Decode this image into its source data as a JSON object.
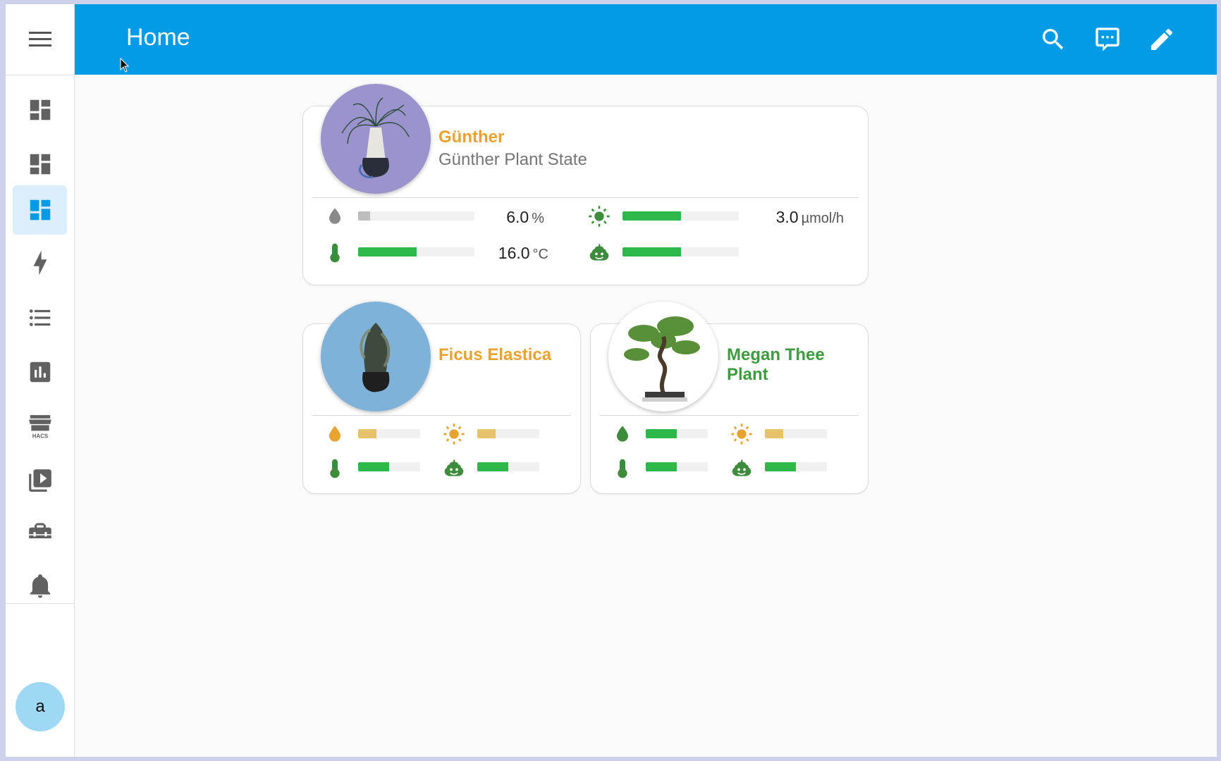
{
  "header": {
    "title": "Home",
    "icons": [
      "search-icon",
      "assist-icon",
      "edit-icon"
    ]
  },
  "sidebar": {
    "menu_icon": "menu-icon",
    "items": [
      {
        "icon": "dashboard-icon",
        "active": false
      },
      {
        "icon": "dashboard-icon",
        "active": false
      },
      {
        "icon": "dashboard-icon",
        "active": true
      },
      {
        "icon": "lightning-icon",
        "active": false
      },
      {
        "icon": "list-icon",
        "active": false
      },
      {
        "icon": "chart-box-icon",
        "active": false
      },
      {
        "icon": "store-icon",
        "active": false,
        "label": "HACS"
      },
      {
        "icon": "media-icon",
        "active": false
      },
      {
        "icon": "toolbox-icon",
        "active": false
      }
    ],
    "notification_icon": "bell-icon",
    "user_initial": "a"
  },
  "colors": {
    "header": "#039be5",
    "accent_active": "#dcedfb",
    "green": "#2db84c",
    "yellow": "#e8c16b",
    "gray": "#bdbdbd",
    "orange_name": "#e8a230",
    "green_name": "#3f9b3f"
  },
  "plants": [
    {
      "name": "Günther",
      "name_color": "#e8a230",
      "subtitle": "Günther Plant State",
      "attributes": [
        {
          "icon": "water-drop-icon",
          "fill": 0.1,
          "color": "#bdbdbd",
          "value": "6.0",
          "unit": "%"
        },
        {
          "icon": "sun-icon",
          "fill": 0.5,
          "color": "#2db84c",
          "value": "3.0",
          "unit": "µmol/h"
        },
        {
          "icon": "thermometer-icon",
          "fill": 0.5,
          "color": "#2db84c",
          "value": "16.0",
          "unit": "°C"
        },
        {
          "icon": "fertilizer-icon",
          "fill": 0.5,
          "color": "#2db84c",
          "value": "",
          "unit": ""
        }
      ]
    },
    {
      "name": "Ficus Elastica",
      "name_color": "#e8a230",
      "subtitle": "",
      "attributes": [
        {
          "icon": "water-drop-icon",
          "fill": 0.3,
          "color": "#e8c16b"
        },
        {
          "icon": "sun-icon",
          "fill": 0.3,
          "color": "#e8c16b"
        },
        {
          "icon": "thermometer-icon",
          "fill": 0.5,
          "color": "#2db84c"
        },
        {
          "icon": "fertilizer-icon",
          "fill": 0.5,
          "color": "#2db84c"
        }
      ]
    },
    {
      "name": "Megan Thee Plant",
      "name_color": "#3f9b3f",
      "subtitle": "",
      "attributes": [
        {
          "icon": "water-drop-icon",
          "fill": 0.5,
          "color": "#2db84c"
        },
        {
          "icon": "sun-icon",
          "fill": 0.3,
          "color": "#e8c16b"
        },
        {
          "icon": "thermometer-icon",
          "fill": 0.5,
          "color": "#2db84c"
        },
        {
          "icon": "fertilizer-icon",
          "fill": 0.5,
          "color": "#2db84c"
        }
      ]
    }
  ]
}
